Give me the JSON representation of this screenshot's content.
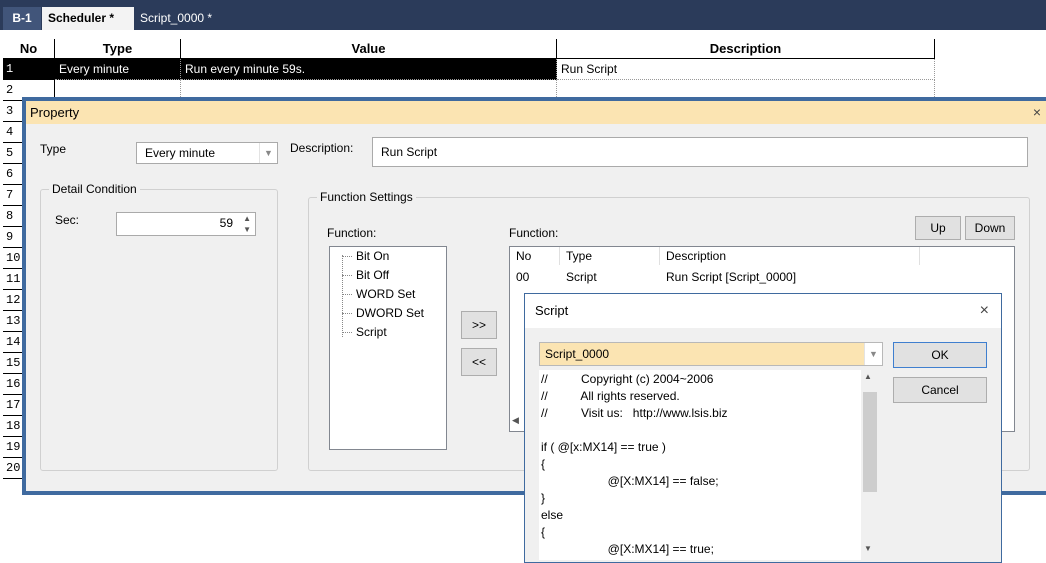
{
  "tabs": {
    "b1": "B-1",
    "scheduler": "Scheduler *",
    "script": "Script_0000 *"
  },
  "grid": {
    "headers": {
      "no": "No",
      "type": "Type",
      "value": "Value",
      "description": "Description"
    },
    "row_numbers": [
      "1",
      "2",
      "3",
      "4",
      "5",
      "6",
      "7",
      "8",
      "9",
      "10",
      "11",
      "12",
      "13",
      "14",
      "15",
      "16",
      "17",
      "18",
      "19",
      "20"
    ],
    "row1": {
      "type": "Every minute",
      "value": "Run every minute 59s.",
      "description": "Run Script"
    }
  },
  "property": {
    "title": "Property",
    "close": "×",
    "type_label": "Type",
    "type_value": "Every minute",
    "description_label": "Description:",
    "description_value": "Run Script",
    "detail_group": "Detail Condition",
    "sec_label": "Sec:",
    "sec_value": "59",
    "function_group": "Function Settings",
    "function_label_left": "Function:",
    "function_label_right": "Function:",
    "functions": [
      "Bit On",
      "Bit Off",
      "WORD Set",
      "DWORD Set",
      "Script"
    ],
    "add_button": ">>",
    "remove_button": "<<",
    "up_button": "Up",
    "down_button": "Down",
    "list_headers": {
      "no": "No",
      "type": "Type",
      "description": "Description"
    },
    "list_row": {
      "no": "00",
      "type": "Script",
      "description": "Run Script [Script_0000]"
    }
  },
  "script_dialog": {
    "title": "Script",
    "close": "×",
    "selected": "Script_0000",
    "ok": "OK",
    "cancel": "Cancel",
    "code_lines": [
      "//          Copyright (c) 2004~2006",
      "//          All rights reserved.",
      "//          Visit us:   http://www.lsis.biz",
      "",
      "if ( @[x:MX14] == true )",
      "{",
      "                    @[X:MX14] == false;",
      "}",
      "else",
      "{",
      "                    @[X:MX14] == true;"
    ]
  },
  "colors": {
    "tabbar": "#2b3b5a",
    "dialog_title": "#fbe4b2",
    "dialog_border": "#3f6a9f",
    "selection": "#000000",
    "combo_highlight": "#fbe4b2"
  }
}
